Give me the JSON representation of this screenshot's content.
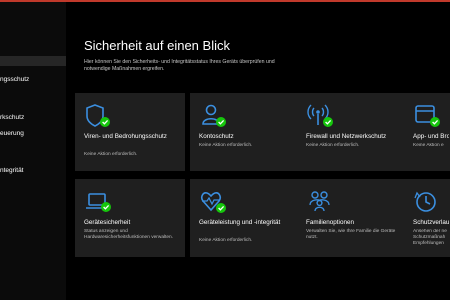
{
  "sidebar": {
    "items": [
      {
        "label": "ngsschutz"
      },
      {
        "label": "rkschutz"
      },
      {
        "label": "euerung"
      },
      {
        "label": "ntegrität"
      }
    ]
  },
  "main": {
    "title": "Sicherheit auf einen Blick",
    "subtitle": "Hier können Sie den Sicherheits- und Integritätsstatus Ihres Geräts überprüfen und notwendige Maßnahmen ergreifen."
  },
  "cards": [
    {
      "title": "Viren- und Bedrohungsschutz",
      "status": "Keine Aktion erforderlich.",
      "icon": "shield-icon",
      "ok": true
    },
    {
      "title": "Kontoschutz",
      "status": "Keine Aktion erforderlich.",
      "icon": "person-icon",
      "ok": true
    },
    {
      "title": "Firewall und Netzwerkschutz",
      "status": "Keine Aktion erforderlich.",
      "icon": "wireless-icon",
      "ok": true
    },
    {
      "title": "App- und Bro",
      "status": "Keine Aktion e",
      "icon": "app-window-icon",
      "ok": true
    },
    {
      "title": "Gerätesicherheit",
      "status": "Status anzeigen und Hardwaresicherheitsfunktionen verwalten.",
      "icon": "laptop-icon",
      "ok": true
    },
    {
      "title": "Geräteleistung und -integrität",
      "status": "Keine Aktion erforderlich.",
      "icon": "heart-pulse-icon",
      "ok": true
    },
    {
      "title": "Familienoptionen",
      "status": "Verwalten Sie, wie Ihre Familie die Geräte nutzt.",
      "icon": "family-icon",
      "ok": false
    },
    {
      "title": "Schutzverlau",
      "status": "Ansehen der ne Schutzmaßnah Empfehlungen",
      "icon": "history-icon",
      "ok": false
    }
  ],
  "colors": {
    "accent": "#3b8fe0",
    "ok_green": "#16c60c",
    "card_bg": "#1f1f1f",
    "top_line": "#c0392b"
  }
}
